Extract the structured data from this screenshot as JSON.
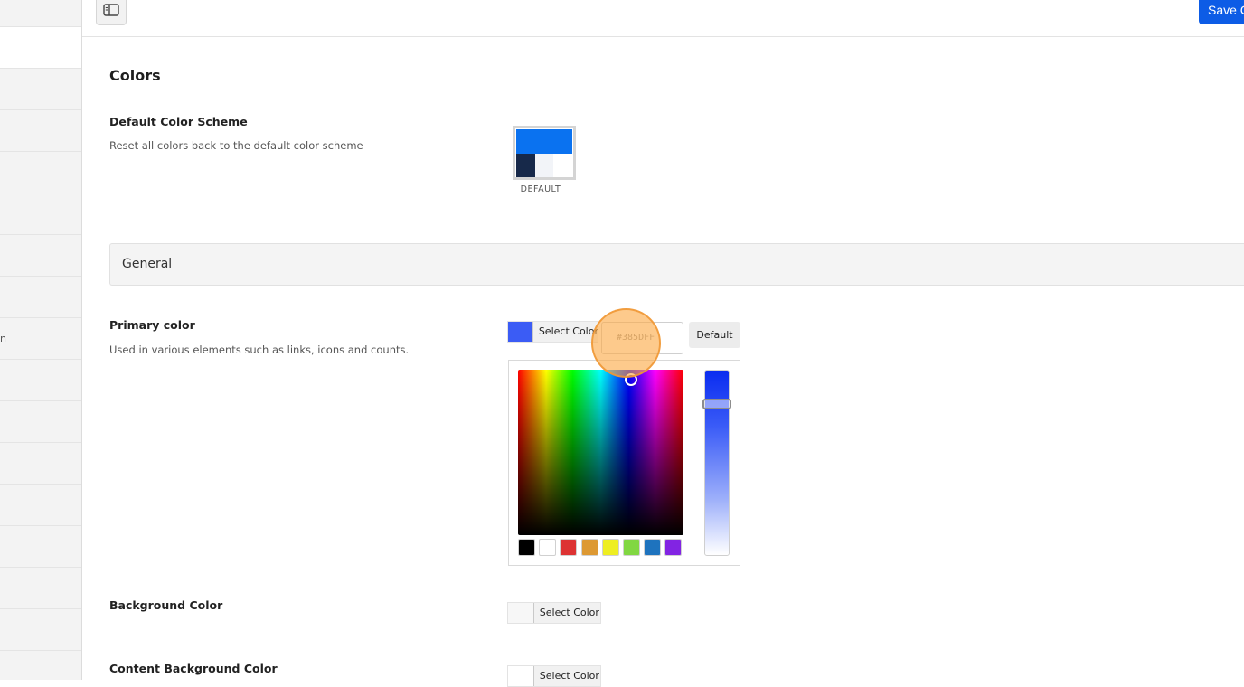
{
  "sidebar": {
    "rows": [
      "",
      "",
      "",
      "",
      "",
      "",
      "",
      "",
      "n",
      "",
      "",
      "",
      "",
      "",
      "",
      ""
    ],
    "active_index": 1
  },
  "toolbar": {
    "sidebar_toggle_icon": "sidebar-toggle-icon",
    "save_label": "Save C"
  },
  "page": {
    "section_title": "Colors"
  },
  "default_scheme": {
    "label": "Default Color Scheme",
    "description": "Reset all colors back to the default color scheme",
    "caption": "DEFAULT",
    "colors": [
      "#0a72f0",
      "#17294a",
      "#f2f4f8",
      "#ffffff"
    ]
  },
  "general": {
    "title": "General"
  },
  "primary_color": {
    "label": "Primary color",
    "description": "Used in various elements such as links, icons and counts.",
    "select_label": "Select Color",
    "hex_value": "#385DFF",
    "default_label": "Default",
    "swatch_color": "#3b5cf5"
  },
  "picker": {
    "presets": [
      "#000000",
      "#ffffff",
      "#dd3333",
      "#dd9933",
      "#eeee22",
      "#81d742",
      "#1e73be",
      "#8224e3"
    ]
  },
  "background_color": {
    "label": "Background Color",
    "select_label": "Select Color",
    "swatch_color": "#f7f7f7"
  },
  "content_background_color": {
    "label": "Content Background Color",
    "select_label": "Select Color"
  }
}
